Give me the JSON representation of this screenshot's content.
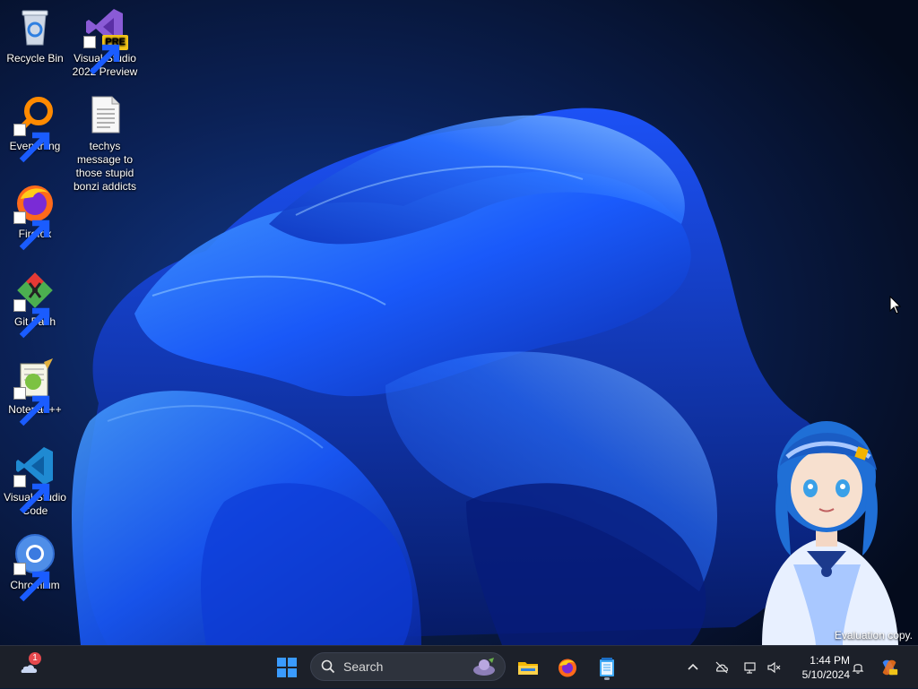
{
  "desktop": {
    "icons": [
      {
        "label": "Recycle Bin",
        "icon": "recycle-bin-icon"
      },
      {
        "label": "Visual Studio 2022 Preview",
        "icon": "visual-studio-preview-icon",
        "badge": "PRE"
      },
      {
        "label": "Everything",
        "icon": "everything-search-icon"
      },
      {
        "label": "techys message to those stupid bonzi addicts",
        "icon": "text-document-icon"
      },
      {
        "label": "Firefox",
        "icon": "firefox-icon"
      },
      {
        "label": "Git Bash",
        "icon": "git-bash-icon"
      },
      {
        "label": "Notepad++",
        "icon": "notepad-plus-plus-icon"
      },
      {
        "label": "Visual Studio Code",
        "icon": "vscode-icon"
      },
      {
        "label": "Chromium",
        "icon": "chromium-icon"
      }
    ],
    "watermark": "Evaluation copy."
  },
  "taskbar": {
    "widgets_badge": "1",
    "search_label": "Search",
    "pinned": [
      "start-icon",
      "file-explorer-icon",
      "firefox-icon",
      "notepad-icon"
    ],
    "clock_time": "1:44 PM",
    "clock_date": "5/10/2024"
  },
  "colors": {
    "taskbar_bg": "#1c2029",
    "accent": "#1e6bff",
    "wallpaper_dark": "#07142f"
  }
}
